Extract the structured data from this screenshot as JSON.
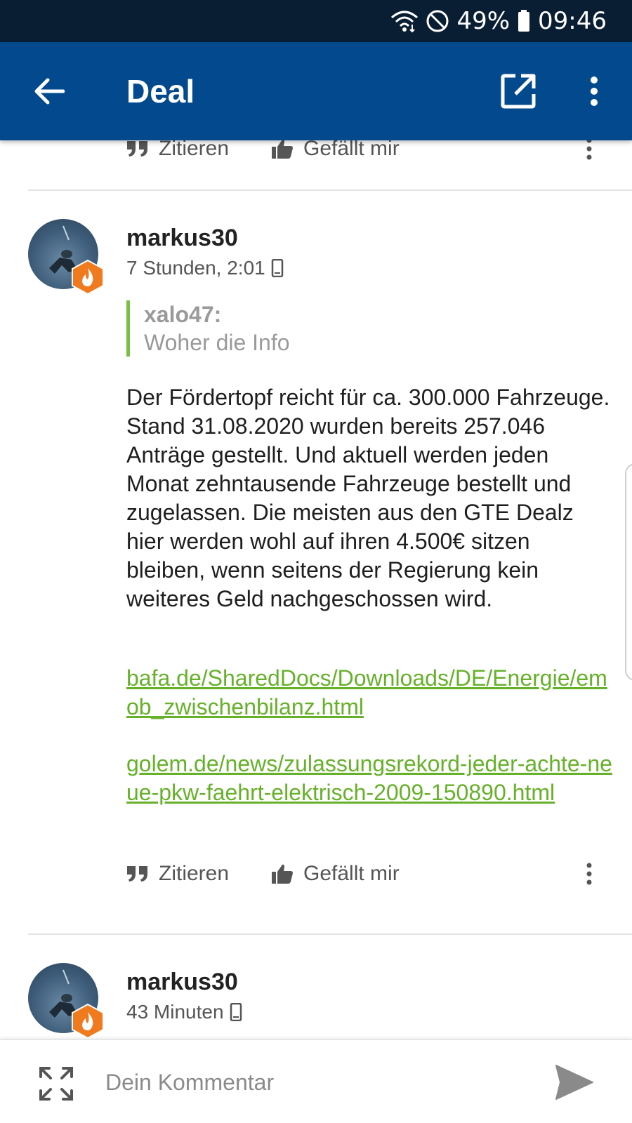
{
  "status_bar": {
    "battery_percent": "49%",
    "time": "09:46",
    "wifi_icon": "wifi-icon",
    "dnd_icon": "do-not-disturb-icon",
    "battery_icon": "battery-icon"
  },
  "app_bar": {
    "title": "Deal",
    "back_icon": "arrow-left-icon",
    "open_external_icon": "open-external-icon",
    "more_icon": "more-vertical-icon",
    "background_color": "#024a8d"
  },
  "actions": {
    "quote_label": "Zitieren",
    "like_label": "Gefällt mir"
  },
  "comments": [
    {
      "author": "markus30",
      "time": "7 Stunden, 2:01",
      "quote": {
        "author": "xalo47:",
        "text": "Woher die Info"
      },
      "body": "Der Fördertopf reicht für ca. 300.000 Fahrzeuge. Stand 31.08.2020 wurden bereits 257.046 Anträge gestellt. Und aktuell werden jeden Monat zehntausende Fahrzeuge bestellt und zugelassen. Die meisten aus den GTE Dealz hier werden wohl auf ihren 4.500€ sitzen bleiben, wenn seitens der Regierung kein weiteres Geld nachgeschossen wird.",
      "links": [
        "bafa.de/SharedDocs/Downloads/DE/Energie/emob_zwischenbilanz.html",
        "golem.de/news/zulassungsrekord-jeder-achte-neue-pkw-faehrt-elektrisch-2009-150890.html"
      ]
    },
    {
      "author": "markus30",
      "time": "43 Minuten"
    }
  ],
  "comment_bar": {
    "placeholder": "Dein Kommentar"
  },
  "colors": {
    "link": "#66b12a",
    "quote_border": "#76c043",
    "badge": "#f07a1e"
  }
}
